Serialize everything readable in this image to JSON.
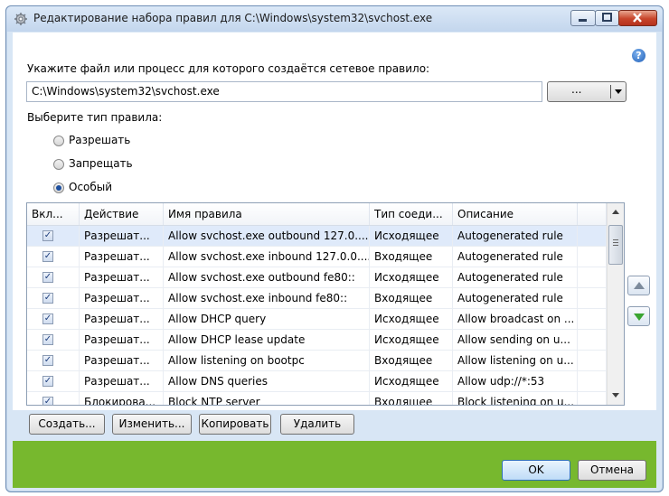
{
  "window": {
    "title": "Редактирование набора правил для C:\\Windows\\system32\\svchost.exe",
    "help_label": "?"
  },
  "file": {
    "prompt": "Укажите файл или процесс для которого создаётся сетевое правило:",
    "path": "C:\\Windows\\system32\\svchost.exe",
    "browse_label": "..."
  },
  "rule_type": {
    "label": "Выберите тип правила:",
    "options": [
      "Разрешать",
      "Запрещать",
      "Особый"
    ],
    "selected": "Особый"
  },
  "table": {
    "columns": [
      "Вкл...",
      "Действие",
      "Имя правила",
      "Тип соеди...",
      "Описание"
    ],
    "rows": [
      {
        "enabled": true,
        "action": "Разрешат...",
        "name": "Allow svchost.exe outbound 127.0....",
        "type": "Исходящее",
        "description": "Autogenerated rule"
      },
      {
        "enabled": true,
        "action": "Разрешат...",
        "name": "Allow svchost.exe inbound 127.0.0....",
        "type": "Входящее",
        "description": "Autogenerated rule"
      },
      {
        "enabled": true,
        "action": "Разрешат...",
        "name": "Allow svchost.exe outbound fe80::",
        "type": "Исходящее",
        "description": "Autogenerated rule"
      },
      {
        "enabled": true,
        "action": "Разрешат...",
        "name": "Allow svchost.exe inbound fe80::",
        "type": "Входящее",
        "description": "Autogenerated rule"
      },
      {
        "enabled": true,
        "action": "Разрешат...",
        "name": "Allow DHCP query",
        "type": "Исходящее",
        "description": "Allow broadcast on ..."
      },
      {
        "enabled": true,
        "action": "Разрешат...",
        "name": "Allow DHCP lease update",
        "type": "Исходящее",
        "description": "Allow sending on u..."
      },
      {
        "enabled": true,
        "action": "Разрешат...",
        "name": "Allow listening on bootpc",
        "type": "Входящее",
        "description": "Allow listening on u..."
      },
      {
        "enabled": true,
        "action": "Разрешат...",
        "name": "Allow DNS queries",
        "type": "Исходящее",
        "description": "Allow udp://*:53"
      },
      {
        "enabled": true,
        "action": "Блокирова...",
        "name": "Block NTP server",
        "type": "Входящее",
        "description": "Block listening on u..."
      }
    ],
    "selected_row": 0
  },
  "actions": {
    "create": "Создать...",
    "edit": "Изменить...",
    "copy": "Копировать",
    "delete": "Удалить"
  },
  "footer": {
    "ok": "OK",
    "cancel": "Отмена"
  },
  "colors": {
    "footer_green": "#77b82e",
    "selected_row": "#dfeafa",
    "move_down_green": "#3aa531"
  }
}
